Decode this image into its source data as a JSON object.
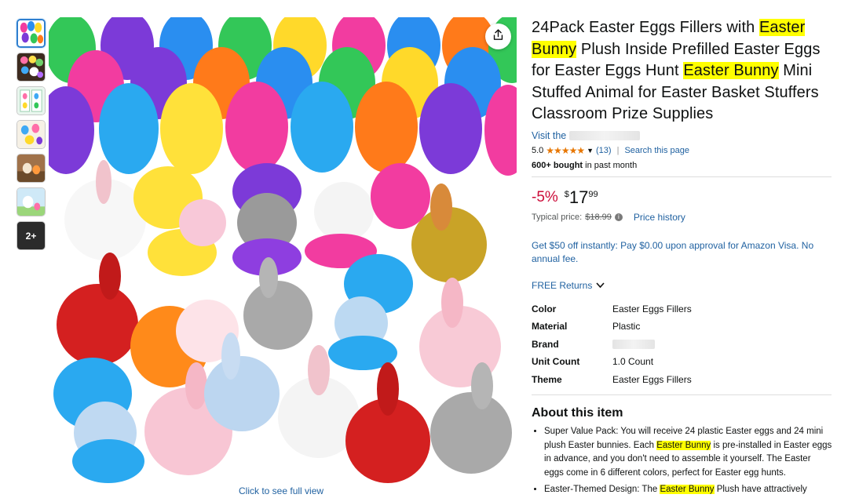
{
  "thumbnails": {
    "more_label": "2+"
  },
  "image": {
    "full_view_label": "Click to see full view"
  },
  "product": {
    "title_parts": {
      "p1": "24Pack Easter Eggs Fillers with ",
      "h1": "Easter Bunny",
      "p2": " Plush Inside Prefilled Easter Eggs for Easter Eggs Hunt ",
      "h2": "Easter Bunny",
      "p3": " Mini Stuffed Animal for Easter Basket Stuffers Classroom Prize Supplies"
    },
    "store_prefix": "Visit the",
    "rating": "5.0",
    "stars": "★★★★★",
    "rating_count": "(13)",
    "search_link": "Search this page",
    "bought_bold": "600+ bought",
    "bought_rest": " in past month"
  },
  "price": {
    "discount": "-5%",
    "currency": "$",
    "whole": "17",
    "fraction": "99",
    "typical_label": "Typical price:",
    "typical_value": "$18.99",
    "history_link": "Price history"
  },
  "promo": {
    "text": "Get $50 off instantly: Pay $0.00 upon approval for Amazon Visa. No annual fee."
  },
  "returns": {
    "label": "FREE Returns"
  },
  "specs": [
    {
      "key": "Color",
      "value": "Easter Eggs Fillers"
    },
    {
      "key": "Material",
      "value": "Plastic"
    },
    {
      "key": "Brand",
      "value": ""
    },
    {
      "key": "Unit Count",
      "value": "1.0 Count"
    },
    {
      "key": "Theme",
      "value": "Easter Eggs Fillers"
    }
  ],
  "about": {
    "heading": "About this item",
    "b1_a": "Super Value Pack: You will receive 24 plastic Easter eggs and 24 mini plush Easter bunnies. Each ",
    "b1_h": "Easter Bunny",
    "b1_b": " is pre-installed in Easter eggs in advance, and you don't need to assemble it yourself. The Easter eggs come in 6 different colors, perfect for Easter egg hunts.",
    "b2_a": "Easter-Themed Design: The ",
    "b2_h": "Easter Bunny",
    "b2_b": " Plush have attractively"
  },
  "colors": {
    "link": "#2162a1",
    "discount": "#cc0c39",
    "star": "#e77600",
    "highlight": "#ffff00",
    "active_thumb_border": "#2e7fcf"
  },
  "icons": {
    "share": "share-icon",
    "chevron": "chevron-down-icon",
    "info": "info-icon"
  }
}
